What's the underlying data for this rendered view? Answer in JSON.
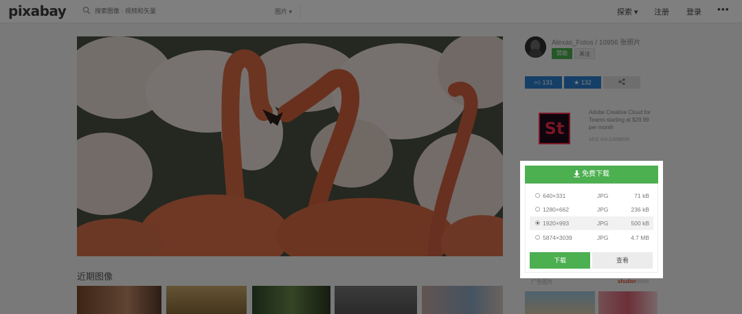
{
  "header": {
    "logo": "pixabay",
    "search_placeholder": "搜索图像 · 视频和矢量",
    "type_select": "图片 ▾",
    "nav_explore": "探索 ▾",
    "nav_register": "注册",
    "nav_login": "登录",
    "nav_more": "•••"
  },
  "author": {
    "line": "Alexas_Fotos / 10956 张照片",
    "follow_green": "赞助",
    "follow": "关注"
  },
  "actions": {
    "likes": "131",
    "favorites": "132"
  },
  "ad": {
    "logo_text": "St",
    "text": "Adobe Creative Cloud for Teams starting at $29.99 per month",
    "via": "ADS VIA CARBON",
    "brand_color": "#f22c4a"
  },
  "download": {
    "free_label": "免费下载",
    "options": [
      {
        "dim": "640×331",
        "fmt": "JPG",
        "size": "71 kB"
      },
      {
        "dim": "1280×662",
        "fmt": "JPG",
        "size": "236 kB"
      },
      {
        "dim": "1920×993",
        "fmt": "JPG",
        "size": "500 kB"
      },
      {
        "dim": "5874×3039",
        "fmt": "JPG",
        "size": "4.7 MB"
      }
    ],
    "selected_index": 2,
    "download_button": "下载",
    "view_button": "查看",
    "accent": "#4caf50"
  },
  "related": {
    "title": "近期图像"
  },
  "sponsored": {
    "label": "广告图片",
    "brand": "shutter",
    "brand_suffix": "stock"
  }
}
